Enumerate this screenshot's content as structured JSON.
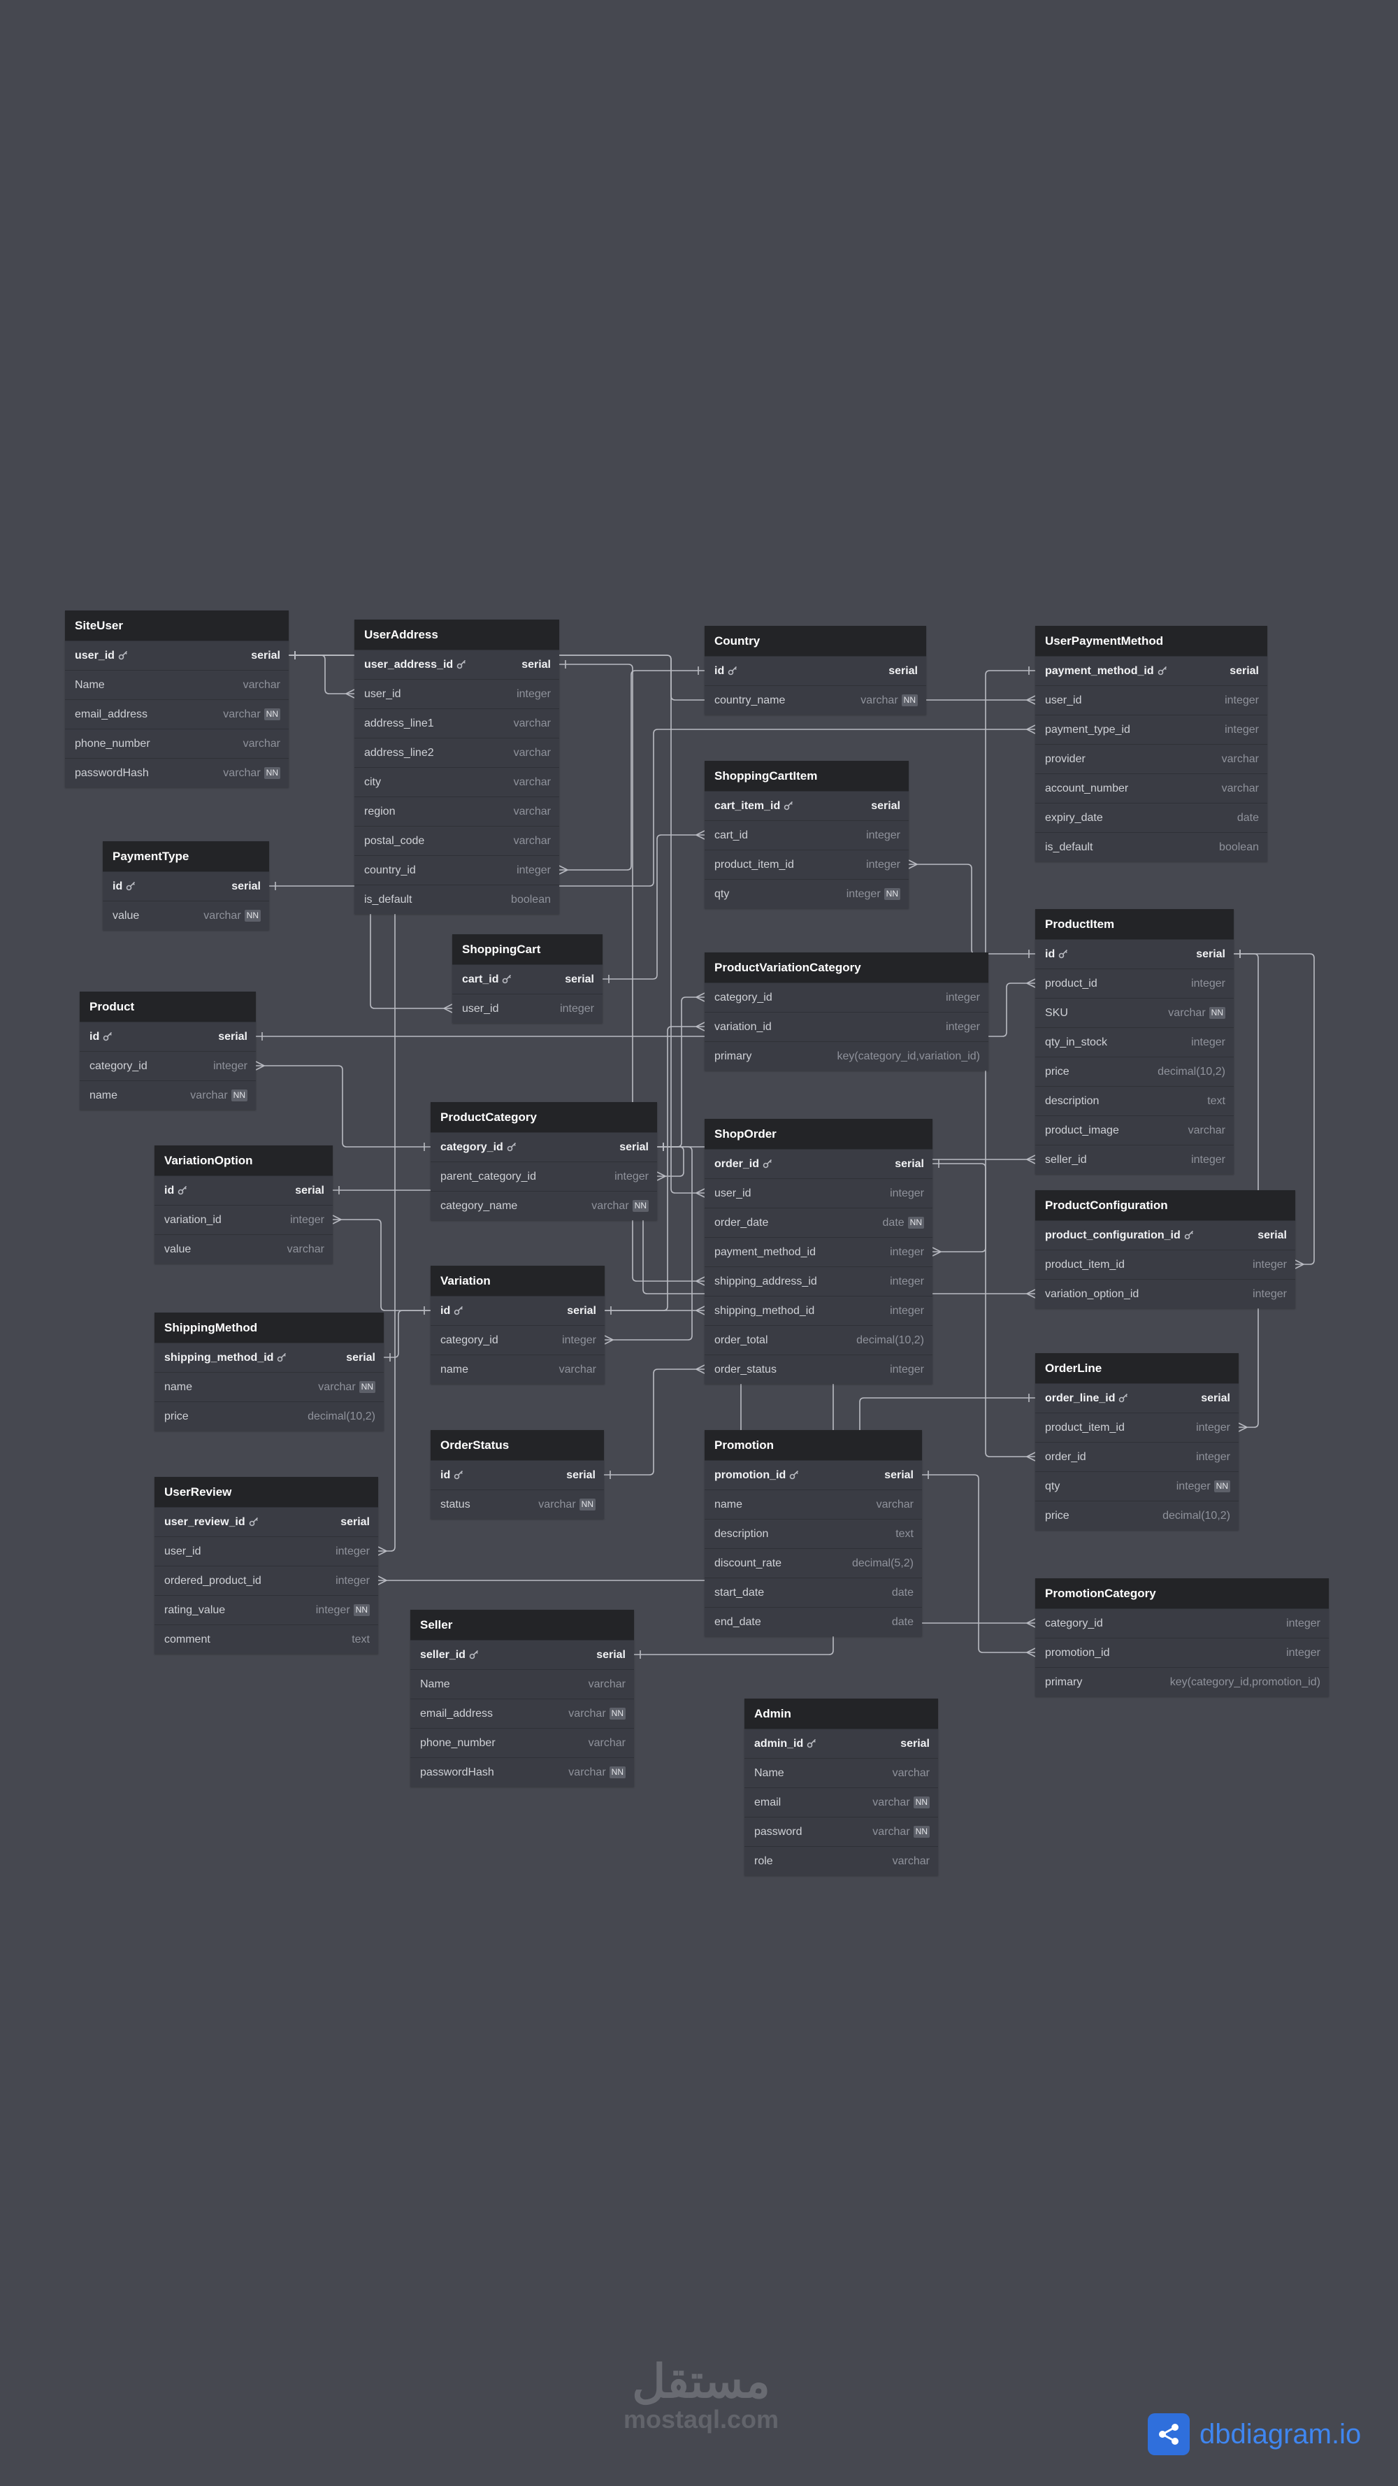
{
  "tables": [
    {
      "name": "SiteUser",
      "fields": [
        {
          "name": "user_id",
          "type": "serial",
          "pk": true
        },
        {
          "name": "Name",
          "type": "varchar"
        },
        {
          "name": "email_address",
          "type": "varchar",
          "nn": true
        },
        {
          "name": "phone_number",
          "type": "varchar"
        },
        {
          "name": "passwordHash",
          "type": "varchar",
          "nn": true
        }
      ]
    },
    {
      "name": "UserAddress",
      "fields": [
        {
          "name": "user_address_id",
          "type": "serial",
          "pk": true
        },
        {
          "name": "user_id",
          "type": "integer"
        },
        {
          "name": "address_line1",
          "type": "varchar"
        },
        {
          "name": "address_line2",
          "type": "varchar"
        },
        {
          "name": "city",
          "type": "varchar"
        },
        {
          "name": "region",
          "type": "varchar"
        },
        {
          "name": "postal_code",
          "type": "varchar"
        },
        {
          "name": "country_id",
          "type": "integer"
        },
        {
          "name": "is_default",
          "type": "boolean"
        }
      ]
    },
    {
      "name": "Country",
      "fields": [
        {
          "name": "id",
          "type": "serial",
          "pk": true
        },
        {
          "name": "country_name",
          "type": "varchar",
          "nn": true
        }
      ]
    },
    {
      "name": "UserPaymentMethod",
      "fields": [
        {
          "name": "payment_method_id",
          "type": "serial",
          "pk": true
        },
        {
          "name": "user_id",
          "type": "integer"
        },
        {
          "name": "payment_type_id",
          "type": "integer"
        },
        {
          "name": "provider",
          "type": "varchar"
        },
        {
          "name": "account_number",
          "type": "varchar"
        },
        {
          "name": "expiry_date",
          "type": "date"
        },
        {
          "name": "is_default",
          "type": "boolean"
        }
      ]
    },
    {
      "name": "ShoppingCartItem",
      "fields": [
        {
          "name": "cart_item_id",
          "type": "serial",
          "pk": true
        },
        {
          "name": "cart_id",
          "type": "integer"
        },
        {
          "name": "product_item_id",
          "type": "integer"
        },
        {
          "name": "qty",
          "type": "integer",
          "nn": true
        }
      ]
    },
    {
      "name": "PaymentType",
      "fields": [
        {
          "name": "id",
          "type": "serial",
          "pk": true
        },
        {
          "name": "value",
          "type": "varchar",
          "nn": true
        }
      ]
    },
    {
      "name": "ShoppingCart",
      "fields": [
        {
          "name": "cart_id",
          "type": "serial",
          "pk": true
        },
        {
          "name": "user_id",
          "type": "integer"
        }
      ]
    },
    {
      "name": "ProductItem",
      "fields": [
        {
          "name": "id",
          "type": "serial",
          "pk": true
        },
        {
          "name": "product_id",
          "type": "integer"
        },
        {
          "name": "SKU",
          "type": "varchar",
          "nn": true
        },
        {
          "name": "qty_in_stock",
          "type": "integer"
        },
        {
          "name": "price",
          "type": "decimal(10,2)"
        },
        {
          "name": "description",
          "type": "text"
        },
        {
          "name": "product_image",
          "type": "varchar"
        },
        {
          "name": "seller_id",
          "type": "integer"
        }
      ]
    },
    {
      "name": "Product",
      "fields": [
        {
          "name": "id",
          "type": "serial",
          "pk": true
        },
        {
          "name": "category_id",
          "type": "integer"
        },
        {
          "name": "name",
          "type": "varchar",
          "nn": true
        }
      ]
    },
    {
      "name": "ProductVariationCategory",
      "fields": [
        {
          "name": "category_id",
          "type": "integer"
        },
        {
          "name": "variation_id",
          "type": "integer"
        },
        {
          "name": "primary",
          "type": "key(category_id,variation_id)"
        }
      ]
    },
    {
      "name": "ProductCategory",
      "fields": [
        {
          "name": "category_id",
          "type": "serial",
          "pk": true
        },
        {
          "name": "parent_category_id",
          "type": "integer"
        },
        {
          "name": "category_name",
          "type": "varchar",
          "nn": true
        }
      ]
    },
    {
      "name": "ShopOrder",
      "fields": [
        {
          "name": "order_id",
          "type": "serial",
          "pk": true
        },
        {
          "name": "user_id",
          "type": "integer"
        },
        {
          "name": "order_date",
          "type": "date",
          "nn": true
        },
        {
          "name": "payment_method_id",
          "type": "integer"
        },
        {
          "name": "shipping_address_id",
          "type": "integer"
        },
        {
          "name": "shipping_method_id",
          "type": "integer"
        },
        {
          "name": "order_total",
          "type": "decimal(10,2)"
        },
        {
          "name": "order_status",
          "type": "integer"
        }
      ]
    },
    {
      "name": "VariationOption",
      "fields": [
        {
          "name": "id",
          "type": "serial",
          "pk": true
        },
        {
          "name": "variation_id",
          "type": "integer"
        },
        {
          "name": "value",
          "type": "varchar"
        }
      ]
    },
    {
      "name": "ProductConfiguration",
      "fields": [
        {
          "name": "product_configuration_id",
          "type": "serial",
          "pk": true
        },
        {
          "name": "product_item_id",
          "type": "integer"
        },
        {
          "name": "variation_option_id",
          "type": "integer"
        }
      ]
    },
    {
      "name": "Variation",
      "fields": [
        {
          "name": "id",
          "type": "serial",
          "pk": true
        },
        {
          "name": "category_id",
          "type": "integer"
        },
        {
          "name": "name",
          "type": "varchar"
        }
      ]
    },
    {
      "name": "ShippingMethod",
      "fields": [
        {
          "name": "shipping_method_id",
          "type": "serial",
          "pk": true
        },
        {
          "name": "name",
          "type": "varchar",
          "nn": true
        },
        {
          "name": "price",
          "type": "decimal(10,2)"
        }
      ]
    },
    {
      "name": "OrderLine",
      "fields": [
        {
          "name": "order_line_id",
          "type": "serial",
          "pk": true
        },
        {
          "name": "product_item_id",
          "type": "integer"
        },
        {
          "name": "order_id",
          "type": "integer"
        },
        {
          "name": "qty",
          "type": "integer",
          "nn": true
        },
        {
          "name": "price",
          "type": "decimal(10,2)"
        }
      ]
    },
    {
      "name": "OrderStatus",
      "fields": [
        {
          "name": "id",
          "type": "serial",
          "pk": true
        },
        {
          "name": "status",
          "type": "varchar",
          "nn": true
        }
      ]
    },
    {
      "name": "Promotion",
      "fields": [
        {
          "name": "promotion_id",
          "type": "serial",
          "pk": true
        },
        {
          "name": "name",
          "type": "varchar"
        },
        {
          "name": "description",
          "type": "text"
        },
        {
          "name": "discount_rate",
          "type": "decimal(5,2)"
        },
        {
          "name": "start_date",
          "type": "date"
        },
        {
          "name": "end_date",
          "type": "date"
        }
      ]
    },
    {
      "name": "UserReview",
      "fields": [
        {
          "name": "user_review_id",
          "type": "serial",
          "pk": true
        },
        {
          "name": "user_id",
          "type": "integer"
        },
        {
          "name": "ordered_product_id",
          "type": "integer"
        },
        {
          "name": "rating_value",
          "type": "integer",
          "nn": true
        },
        {
          "name": "comment",
          "type": "text"
        }
      ]
    },
    {
      "name": "PromotionCategory",
      "fields": [
        {
          "name": "category_id",
          "type": "integer"
        },
        {
          "name": "promotion_id",
          "type": "integer"
        },
        {
          "name": "primary",
          "type": "key(category_id,promotion_id)"
        }
      ]
    },
    {
      "name": "Seller",
      "fields": [
        {
          "name": "seller_id",
          "type": "serial",
          "pk": true
        },
        {
          "name": "Name",
          "type": "varchar"
        },
        {
          "name": "email_address",
          "type": "varchar",
          "nn": true
        },
        {
          "name": "phone_number",
          "type": "varchar"
        },
        {
          "name": "passwordHash",
          "type": "varchar",
          "nn": true
        }
      ]
    },
    {
      "name": "Admin",
      "fields": [
        {
          "name": "admin_id",
          "type": "serial",
          "pk": true
        },
        {
          "name": "Name",
          "type": "varchar"
        },
        {
          "name": "email",
          "type": "varchar",
          "nn": true
        },
        {
          "name": "password",
          "type": "varchar",
          "nn": true
        },
        {
          "name": "role",
          "type": "varchar"
        }
      ]
    }
  ],
  "nn_label": "NN",
  "watermark": {
    "arabic": "مستقل",
    "latin": "mostaql.com"
  },
  "brand": {
    "name": "dbdiagram",
    "suffix": ".io",
    "accent": "#3f86f0",
    "logo_color": "#2f6fdc"
  },
  "colors": {
    "background": "#464850",
    "table_header": "#232427",
    "table_body": "#3a3c44",
    "connector": "#b9bbc2"
  }
}
